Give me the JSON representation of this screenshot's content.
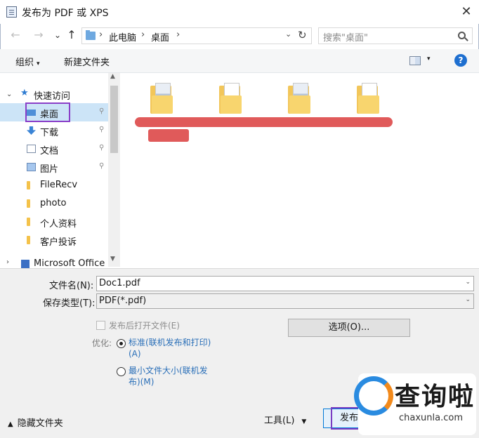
{
  "window": {
    "title": "发布为 PDF 或 XPS",
    "close_glyph": "✕"
  },
  "nav": {
    "back_glyph": "←",
    "forward_glyph": "→",
    "recent_glyph": "⌄",
    "up_glyph": "↑",
    "path": [
      "此电脑",
      "桌面"
    ],
    "separator": "›",
    "search_placeholder": "搜索\"桌面\""
  },
  "toolbar": {
    "organize_label": "组织",
    "new_folder_label": "新建文件夹",
    "help_glyph": "?"
  },
  "sidebar": {
    "quick_access_label": "快速访问",
    "items": [
      {
        "label": "桌面",
        "icon": "desktop-icon",
        "pinned": true,
        "selected": true
      },
      {
        "label": "下载",
        "icon": "download-icon",
        "pinned": true
      },
      {
        "label": "文档",
        "icon": "document-icon",
        "pinned": true
      },
      {
        "label": "图片",
        "icon": "picture-icon",
        "pinned": true
      },
      {
        "label": "FileRecv",
        "icon": "folder-icon"
      },
      {
        "label": "photo",
        "icon": "folder-icon"
      },
      {
        "label": "个人资料",
        "icon": "folder-icon"
      },
      {
        "label": "客户投诉",
        "icon": "folder-icon"
      }
    ],
    "office_label": "Microsoft Office",
    "pin_glyph": "📌"
  },
  "form": {
    "filename_label": "文件名(N):",
    "filename_value": "Doc1.pdf",
    "filetype_label": "保存类型(T):",
    "filetype_value": "PDF(*.pdf)",
    "open_after_label": "发布后打开文件(E)",
    "options_button": "选项(O)...",
    "optimize_label": "优化:",
    "radio_standard": "标准(联机发布和打印)\n(A)",
    "radio_minimum": "最小文件大小(联机发\n布)(M)",
    "hide_folders_label": "隐藏文件夹",
    "tools_label": "工具(L)",
    "publish_label": "发布",
    "cancel_label": ""
  },
  "watermark": {
    "text": "查询啦",
    "url": "chaxunla.com"
  },
  "colors": {
    "accent": "#0078d7",
    "highlight": "#8a3fc8",
    "redaction": "#e05a5a"
  }
}
